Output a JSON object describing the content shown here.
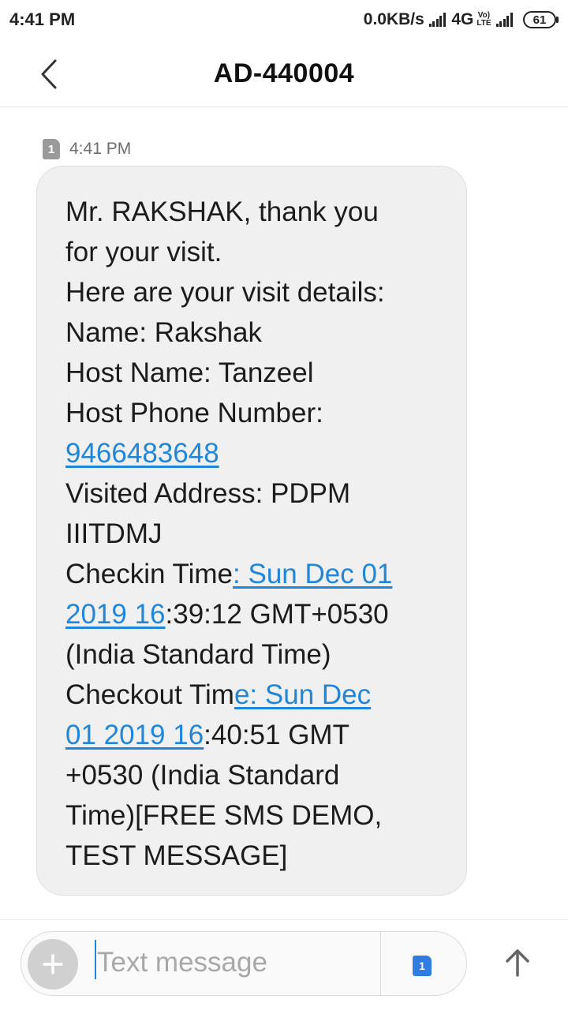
{
  "status_bar": {
    "time": "4:41 PM",
    "net_speed": "0.0KB/s",
    "network_type": "4G",
    "volte_top": "Vo)",
    "volte_bottom": "LTE",
    "battery": "61"
  },
  "header": {
    "title": "AD-440004",
    "back_icon": "chevron-left-icon"
  },
  "conversation": {
    "message": {
      "sim_slot": "1",
      "time": "4:41 PM",
      "lines": [
        [
          {
            "t": "Mr. RAKSHAK, thank you"
          }
        ],
        [
          {
            "t": "for your visit."
          }
        ],
        [
          {
            "t": "Here are your visit details:"
          }
        ],
        [
          {
            "t": "Name: Rakshak"
          }
        ],
        [
          {
            "t": "Host Name: Tanzeel"
          }
        ],
        [
          {
            "t": "Host Phone Number:"
          }
        ],
        [
          {
            "t": "9466483648",
            "link": true
          }
        ],
        [
          {
            "t": "Visited Address: PDPM"
          }
        ],
        [
          {
            "t": "IIITDMJ"
          }
        ],
        [
          {
            "t": "Checkin Time"
          },
          {
            "t": ": Sun Dec 01",
            "link": true
          }
        ],
        [
          {
            "t": "2019 16",
            "link": true
          },
          {
            "t": ":39:12 GMT+0530"
          }
        ],
        [
          {
            "t": "(India Standard Time)"
          }
        ],
        [
          {
            "t": "Checkout Tim"
          },
          {
            "t": "e: Sun Dec",
            "link": true
          }
        ],
        [
          {
            "t": "01 2019 16",
            "link": true
          },
          {
            "t": ":40:51 GMT"
          }
        ],
        [
          {
            "t": "+0530 (India Standard"
          }
        ],
        [
          {
            "t": "Time)[FREE SMS DEMO,"
          }
        ],
        [
          {
            "t": "TEST MESSAGE]"
          }
        ]
      ]
    }
  },
  "compose": {
    "placeholder": "Text message",
    "sim_slot": "1",
    "add_icon": "plus-icon",
    "send_icon": "arrow-up-icon"
  },
  "colors": {
    "link": "#1f86d9",
    "bubble": "#f0f0f0",
    "sim_badge_active": "#2f7de1",
    "sim_badge_message": "#9a9a9a"
  }
}
